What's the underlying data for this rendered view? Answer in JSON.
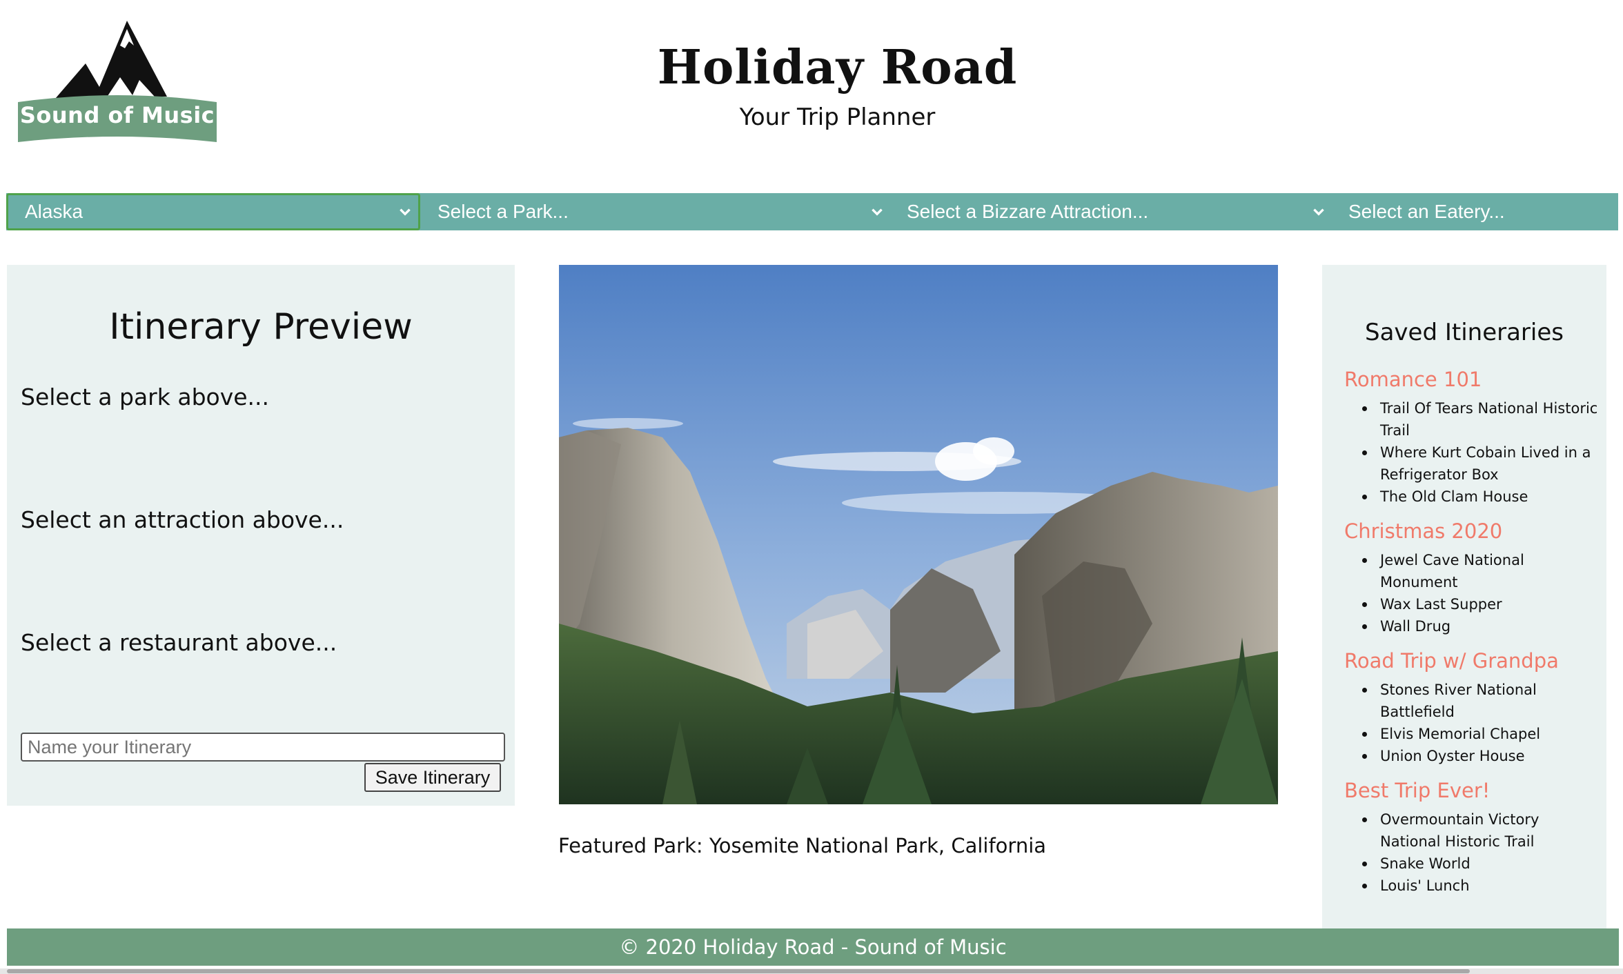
{
  "header": {
    "logo_text": "Sound of Music",
    "title": "Holiday Road",
    "subtitle": "Your Trip Planner"
  },
  "filters": {
    "state": {
      "selected": "Alaska"
    },
    "park": {
      "selected": "Select a Park..."
    },
    "attraction": {
      "selected": "Select a Bizzare Attraction..."
    },
    "eatery": {
      "selected": "Select an Eatery..."
    }
  },
  "preview": {
    "title": "Itinerary Preview",
    "park_line": "Select a park above...",
    "attraction_line": "Select an attraction above...",
    "restaurant_line": "Select a restaurant above...",
    "name_placeholder": "Name your Itinerary",
    "save_label": "Save Itinerary"
  },
  "featured": {
    "caption": "Featured Park: Yosemite National Park, California"
  },
  "saved": {
    "title": "Saved Itineraries",
    "itineraries": [
      {
        "name": "Romance 101",
        "items": [
          "Trail Of Tears National Historic Trail",
          "Where Kurt Cobain Lived in a Refrigerator Box",
          "The Old Clam House"
        ]
      },
      {
        "name": "Christmas 2020",
        "items": [
          "Jewel Cave National Monument",
          "Wax Last Supper",
          "Wall Drug"
        ]
      },
      {
        "name": "Road Trip w/ Grandpa",
        "items": [
          "Stones River National Battlefield",
          "Elvis Memorial Chapel",
          "Union Oyster House"
        ]
      },
      {
        "name": "Best Trip Ever!",
        "items": [
          "Overmountain Victory National Historic Trail",
          "Snake World",
          "Louis' Lunch"
        ]
      }
    ]
  },
  "footer": {
    "text": "© 2020 Holiday Road - Sound of Music"
  },
  "colors": {
    "filter_bar": "#6aaea6",
    "panel_bg": "#eaf2f1",
    "itinerary_name": "#f07a6a",
    "footer_bg": "#6e9e7f",
    "logo_banner": "#6e9e7f"
  },
  "icons": {
    "logo": "mountain-logo-icon",
    "select_arrow": "chevron-down-icon",
    "photo": "yosemite-valley-photo"
  }
}
